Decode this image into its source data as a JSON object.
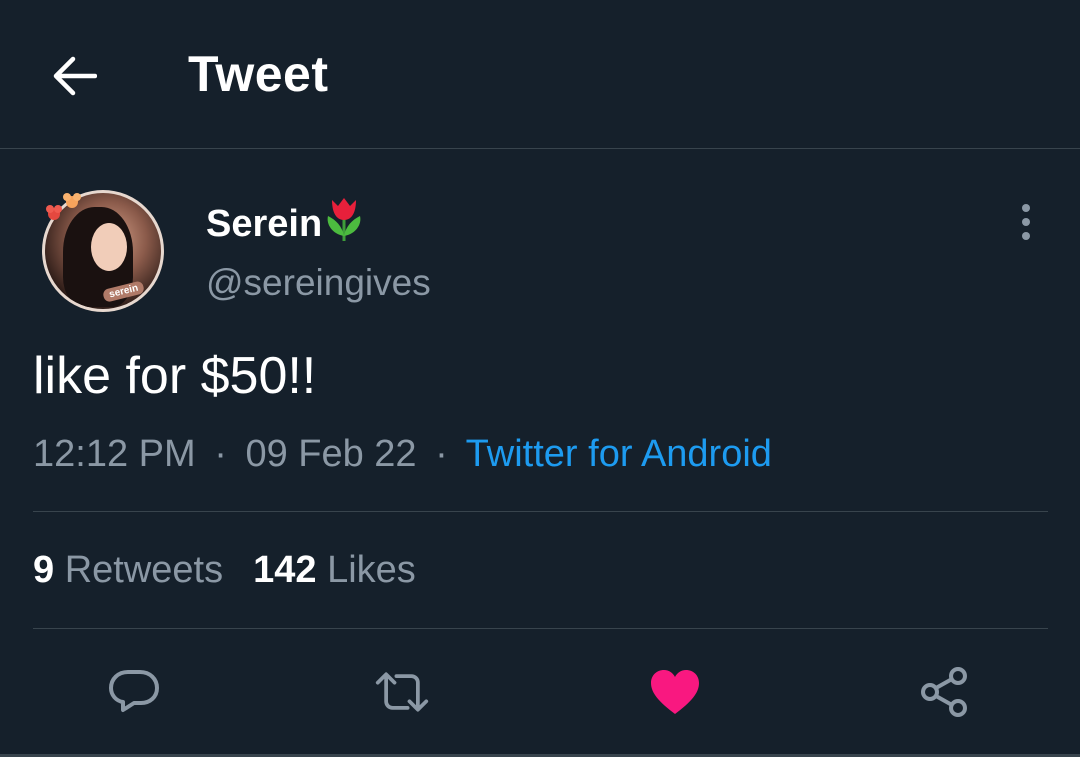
{
  "header": {
    "title": "Tweet",
    "back_icon": "arrow-left-icon"
  },
  "author": {
    "display_name": "Serein",
    "name_emoji": "tulip-emoji",
    "handle": "@sereingives",
    "avatar_label": "serein"
  },
  "tweet": {
    "text": "like for $50!!",
    "time": "12:12 PM",
    "date": "09 Feb 22",
    "separator": "·",
    "source": "Twitter for Android"
  },
  "stats": {
    "retweets_count": "9",
    "retweets_label": "Retweets",
    "likes_count": "142",
    "likes_label": "Likes"
  },
  "actions": [
    "reply-icon",
    "retweet-icon",
    "like-icon",
    "share-icon"
  ],
  "colors": {
    "background": "#15202b",
    "text": "#ffffff",
    "secondary_text": "#8b98a5",
    "link": "#1d9bf0",
    "like_active": "#f91880",
    "divider": "#38444d"
  }
}
